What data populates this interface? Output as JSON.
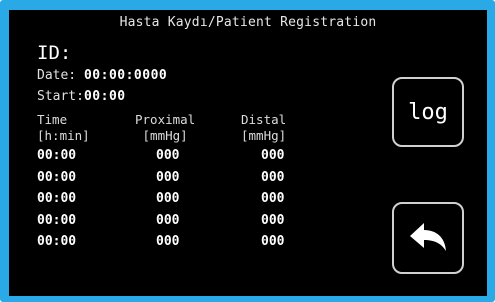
{
  "header": {
    "title": "Hasta Kaydı/Patient Registration"
  },
  "patient": {
    "id_label": "ID:",
    "date_label": "Date:",
    "date_value": "00:00:0000",
    "start_label": "Start:",
    "start_value": "00:00"
  },
  "table": {
    "headers": [
      {
        "line1": "Time",
        "line2": "[h:min]"
      },
      {
        "line1": "Proximal",
        "line2": "[mmHg]"
      },
      {
        "line1": "Distal",
        "line2": "[mmHg]"
      }
    ],
    "rows": [
      {
        "time": "00:00",
        "proximal": "000",
        "distal": "000"
      },
      {
        "time": "00:00",
        "proximal": "000",
        "distal": "000"
      },
      {
        "time": "00:00",
        "proximal": "000",
        "distal": "000"
      },
      {
        "time": "00:00",
        "proximal": "000",
        "distal": "000"
      },
      {
        "time": "00:00",
        "proximal": "000",
        "distal": "000"
      }
    ]
  },
  "buttons": {
    "log_label": "log",
    "back_icon": "back-arrow-icon"
  },
  "colors": {
    "frame": "#29a9e6",
    "screen": "#000000",
    "text": "#ffffff",
    "button_border": "#d0d0d0"
  }
}
